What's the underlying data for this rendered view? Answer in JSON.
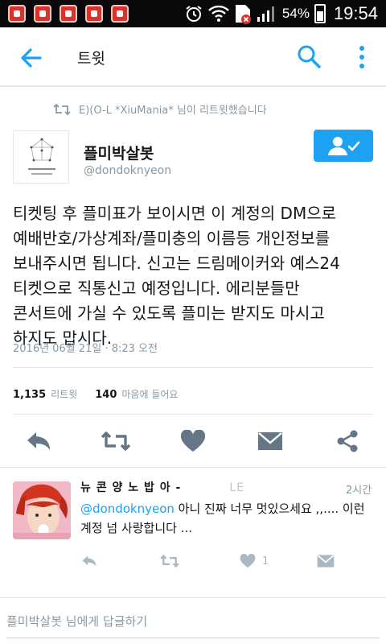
{
  "status_bar": {
    "battery_percent": "54%",
    "time": "19:54"
  },
  "appbar": {
    "title": "트윗"
  },
  "retweet_header": {
    "text": "E)(O-L *XiuMania* 님이 리트윗했습니다"
  },
  "author": {
    "name": "플미박살봇",
    "handle": "@dondoknyeon"
  },
  "tweet": {
    "text": "티켓팅 후 플미표가 보이시면 이 계정의 DM으로\n예배반호/가상계좌/플미충의 이름등 개인정보를\n보내주시면 됩니다. 신고는 드림메이커와 예스24\n티켓으로 직통신고 예정입니다. 에리분들만\n콘서트에 가실 수 있도록 플미는 받지도 마시고\n하지도 맙시다.",
    "timestamp": "2016년 06월 21일 · 8:23 오전"
  },
  "stats": {
    "retweets_count": "1,135",
    "retweets_label": "리트윗",
    "likes_count": "140",
    "likes_label": "마음에 들어요"
  },
  "reply": {
    "name": "뉴 콘 양 노 밥 아 -",
    "name_suffix": "LE",
    "time": "2시간",
    "mention": "@dondoknyeon",
    "text_after_mention": " 아니 진짜 너무 멋있으세요 ,,.... 이런 계정 넘 사랑합니다 ...",
    "like_count": "1"
  },
  "compose": {
    "placeholder": "플미박살봇 님에게 답글하기"
  },
  "colors": {
    "accent": "#1da1f2",
    "muted": "#8899a6",
    "icon_gray": "#657786",
    "divider": "#e1e8ed"
  }
}
